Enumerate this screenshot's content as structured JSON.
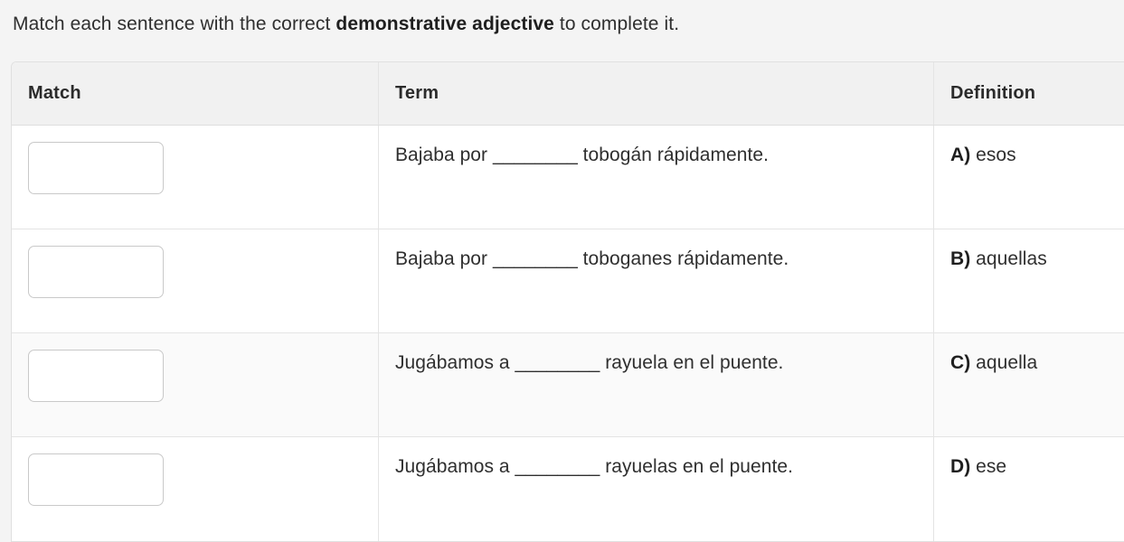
{
  "prompt": {
    "before": "Match each sentence with the correct ",
    "emphasis": "demonstrative adjective",
    "after": " to complete it."
  },
  "table": {
    "headers": {
      "match": "Match",
      "term": "Term",
      "definition": "Definition"
    },
    "rows": [
      {
        "answer_value": "",
        "answer_placeholder": "",
        "term": "Bajaba por ________ tobogán rápidamente.",
        "def_letter": "A)",
        "def_text": " esos",
        "shaded": false
      },
      {
        "answer_value": "",
        "answer_placeholder": "",
        "term": "Bajaba por ________ toboganes rápidamente.",
        "def_letter": "B)",
        "def_text": " aquellas",
        "shaded": false
      },
      {
        "answer_value": "",
        "answer_placeholder": "",
        "term": "Jugábamos a ________ rayuela en el puente.",
        "def_letter": "C)",
        "def_text": " aquella",
        "shaded": true
      },
      {
        "answer_value": "",
        "answer_placeholder": "",
        "term": "Jugábamos a ________ rayuelas en el puente.",
        "def_letter": "D)",
        "def_text": " ese",
        "shaded": false
      }
    ]
  },
  "colors": {
    "page_background": "#f4f4f4",
    "table_background": "#ffffff",
    "header_background": "#f1f1f1",
    "shaded_row_background": "#fafafa",
    "border": "#e4e4e4",
    "text": "#2f2f2f"
  }
}
